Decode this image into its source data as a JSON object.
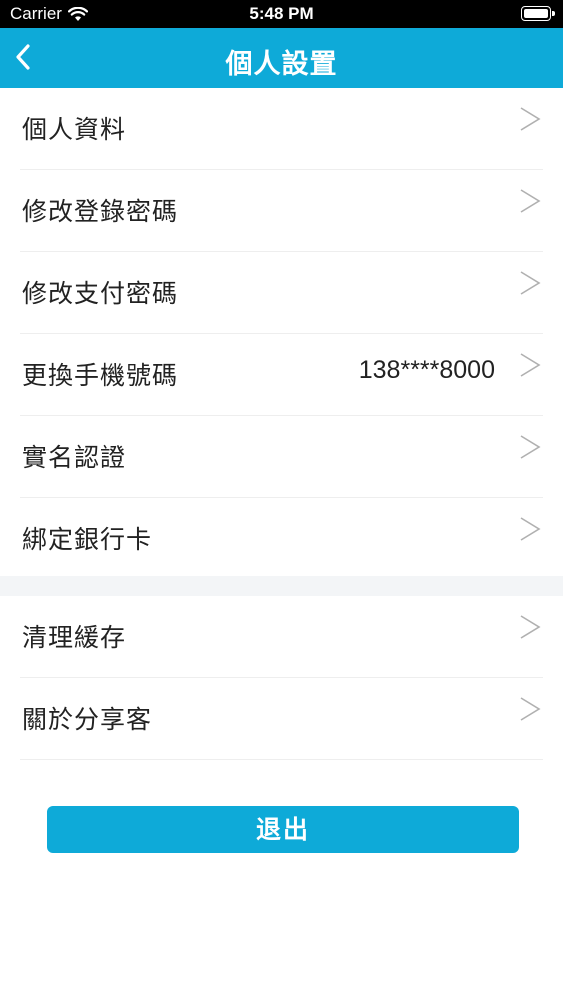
{
  "status_bar": {
    "carrier": "Carrier",
    "time": "5:48 PM",
    "icons": [
      "wifi-icon",
      "battery-icon"
    ]
  },
  "nav": {
    "title": "個人設置",
    "back_icon": "chevron-left-icon",
    "background_color": "#0eaad8"
  },
  "settings_group_1": [
    {
      "label": "個人資料",
      "value": ""
    },
    {
      "label": "修改登錄密碼",
      "value": ""
    },
    {
      "label": "修改支付密碼",
      "value": ""
    },
    {
      "label": "更換手機號碼",
      "value": "138****8000"
    },
    {
      "label": "實名認證",
      "value": ""
    },
    {
      "label": "綁定銀行卡",
      "value": ""
    }
  ],
  "settings_group_2": [
    {
      "label": "清理緩存",
      "value": ""
    },
    {
      "label": "關於分享客",
      "value": ""
    }
  ],
  "logout": {
    "label": "退出",
    "color": "#0eaad8"
  }
}
